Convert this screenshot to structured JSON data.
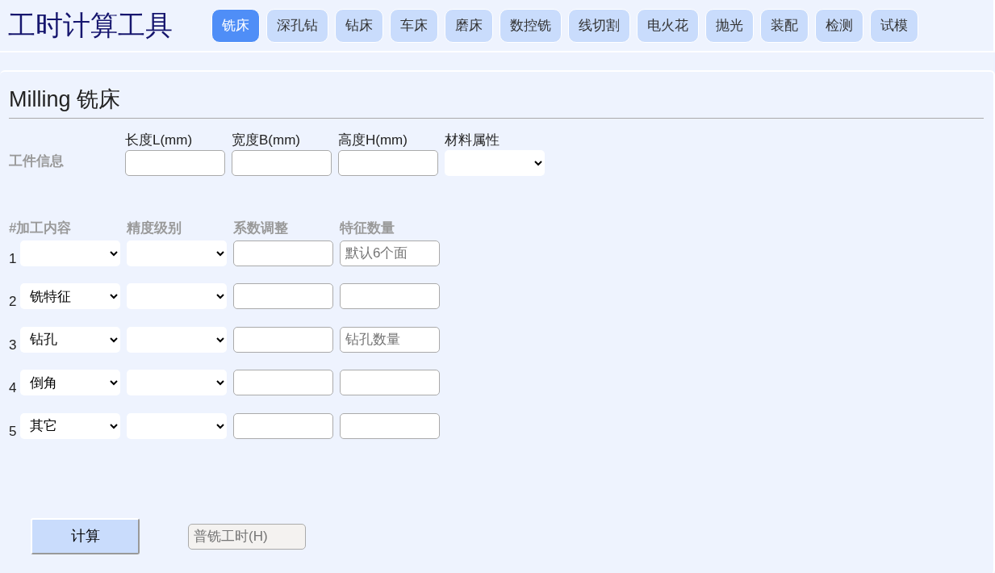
{
  "app_title": "工时计算工具",
  "tabs": [
    {
      "label": "铣床",
      "selected": true
    },
    {
      "label": "深孔钻",
      "selected": false
    },
    {
      "label": "钻床",
      "selected": false
    },
    {
      "label": "车床",
      "selected": false
    },
    {
      "label": "磨床",
      "selected": false
    },
    {
      "label": "数控铣",
      "selected": false
    },
    {
      "label": "线切割",
      "selected": false
    },
    {
      "label": "电火花",
      "selected": false
    },
    {
      "label": "抛光",
      "selected": false
    },
    {
      "label": "装配",
      "selected": false
    },
    {
      "label": "检测",
      "selected": false
    },
    {
      "label": "试模",
      "selected": false
    }
  ],
  "section_title": "Milling 铣床",
  "workpiece": {
    "label": "工件信息",
    "fields": [
      {
        "kind": "input",
        "label": "长度L(mm)"
      },
      {
        "kind": "input",
        "label": "宽度B(mm)"
      },
      {
        "kind": "input",
        "label": "高度H(mm)"
      },
      {
        "kind": "select",
        "label": "材料属性"
      }
    ]
  },
  "operations": {
    "columns": [
      "#",
      "加工内容",
      "精度级别",
      "系数调整",
      "特征数量"
    ],
    "rows": [
      {
        "number": "1",
        "content": "",
        "count_placeholder": "默认6个面"
      },
      {
        "number": "2",
        "content": "铣特征"
      },
      {
        "number": "3",
        "content": "钻孔",
        "count_placeholder": "钻孔数量"
      },
      {
        "number": "4",
        "content": "倒角"
      },
      {
        "number": "5",
        "content": "其它"
      }
    ]
  },
  "calculate_button": "计算",
  "result": {
    "placeholder": "普铣工时(H)"
  }
}
